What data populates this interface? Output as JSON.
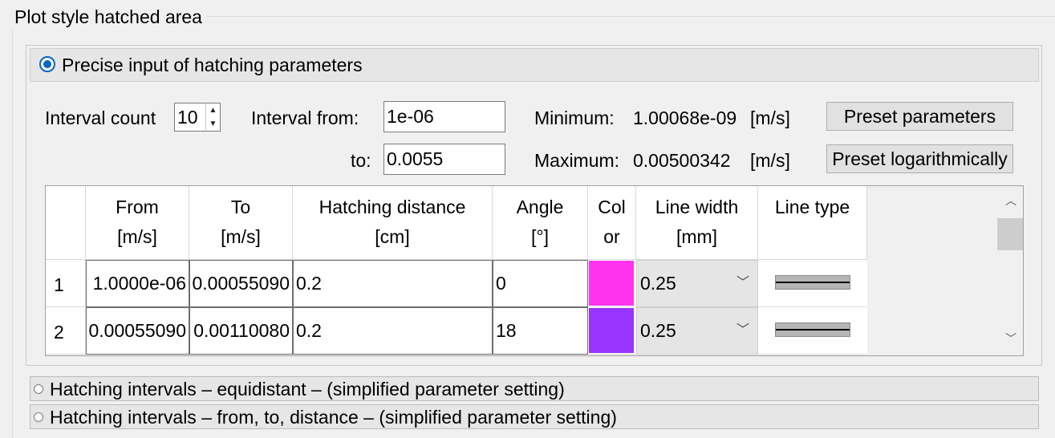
{
  "title": "Plot style hatched area",
  "sections": {
    "precise": "Precise input of hatching parameters",
    "equidistant": "Hatching intervals – equidistant – (simplified parameter setting)",
    "from_to": "Hatching intervals – from, to, distance – (simplified parameter setting)"
  },
  "params": {
    "interval_count_label": "Interval count",
    "interval_count": "10",
    "interval_from_label": "Interval  from:",
    "interval_from": "1e-06",
    "to_label": "to:",
    "interval_to": "0.0055",
    "minimum_label": "Minimum:",
    "minimum_value": "1.00068e-09",
    "maximum_label": "Maximum:",
    "maximum_value": "0.00500342",
    "unit": "[m/s]",
    "preset_button": "Preset parameters",
    "preset_log_button": "Preset logarithmically"
  },
  "grid": {
    "headers": [
      "From\n[m/s]",
      "To\n[m/s]",
      "Hatching distance\n[cm]",
      "Angle\n[°]",
      "Col\nor",
      "Line width\n[mm]",
      "Line type"
    ],
    "rows": [
      {
        "num": "1",
        "from": "1.0000e-06",
        "to": "0.00055090",
        "distance": "0.2",
        "angle": "0",
        "color": "#ff33ee",
        "width": "0.25"
      },
      {
        "num": "2",
        "from": "0.00055090",
        "to": "0.00110080",
        "distance": "0.2",
        "angle": "18",
        "color": "#9933ff",
        "width": "0.25"
      }
    ]
  }
}
